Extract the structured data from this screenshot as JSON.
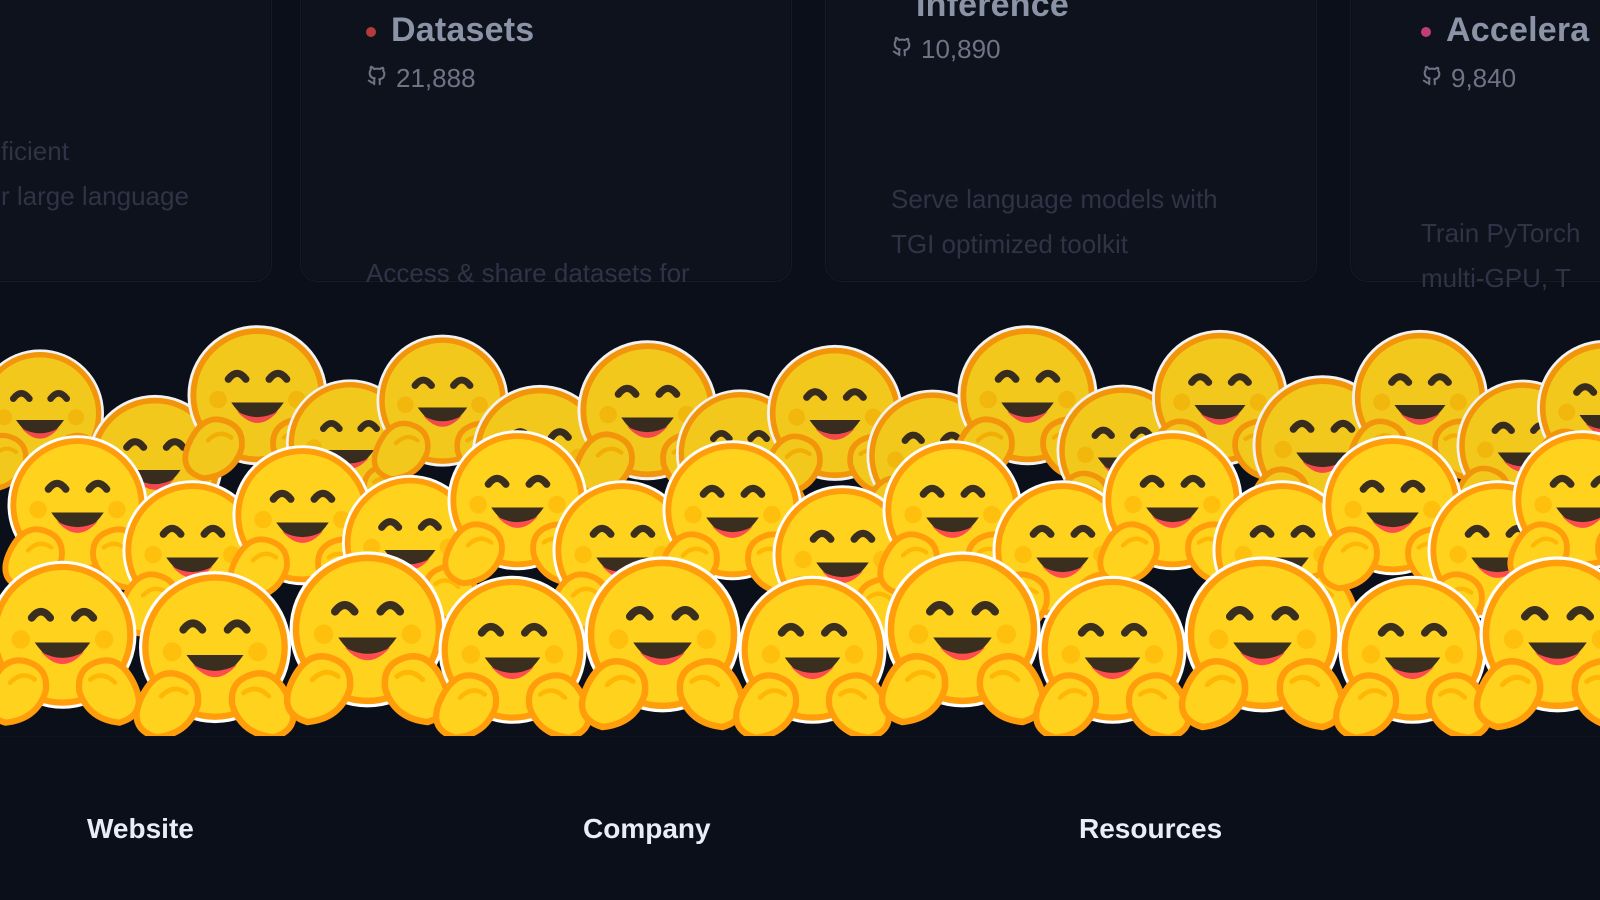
{
  "cards": [
    {
      "title": "",
      "stars": "",
      "desc": [
        "ficient",
        "r large language"
      ]
    },
    {
      "title": "Datasets",
      "stars": "21,888",
      "desc": [
        "Access & share datasets for"
      ],
      "dot_color": "#b23b3b"
    },
    {
      "title": "Inference",
      "stars": "10,890",
      "desc": [
        "Serve language models with",
        "TGI optimized toolkit"
      ],
      "dot_color": "#b23b3b"
    },
    {
      "title": "Accelera",
      "stars": "9,840",
      "desc": [
        "Train PyTorch",
        "multi-GPU, T"
      ],
      "dot_color": "#c13d7a"
    }
  ],
  "footer": {
    "website_label": "Website",
    "company_label": "Company",
    "resources_label": "Resources"
  },
  "colors": {
    "background": "#0b0f19",
    "emoji_yellow": "#ffd21e",
    "emoji_orange": "#ff9d0b"
  },
  "icons": {
    "star_icon": "github-icon",
    "emoji_icon": "hugging-face-icon"
  }
}
